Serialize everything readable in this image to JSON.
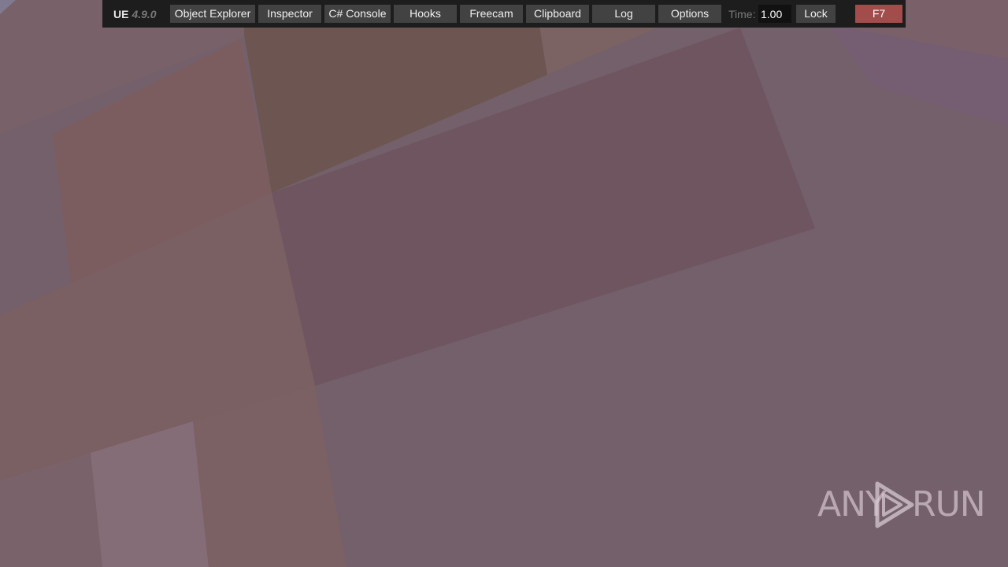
{
  "toolbar": {
    "brand": "UE",
    "version": "4.9.0",
    "buttons": {
      "object_explorer": "Object Explorer",
      "inspector": "Inspector",
      "csharp_console": "C# Console",
      "hooks": "Hooks",
      "freecam": "Freecam",
      "clipboard": "Clipboard",
      "log": "Log",
      "options": "Options",
      "lock": "Lock",
      "hide": "F7"
    },
    "time_label": "Time:",
    "time_value": "1.00"
  },
  "watermark": {
    "left": "ANY",
    "right": "RUN"
  },
  "colors": {
    "toolbar_bg": "#1d1d1d",
    "button_bg": "#424242",
    "hide_button": "#a24c4c",
    "scene_base": "#74606a"
  },
  "icons": {
    "watermark_logo": "play-triangle-icon"
  }
}
